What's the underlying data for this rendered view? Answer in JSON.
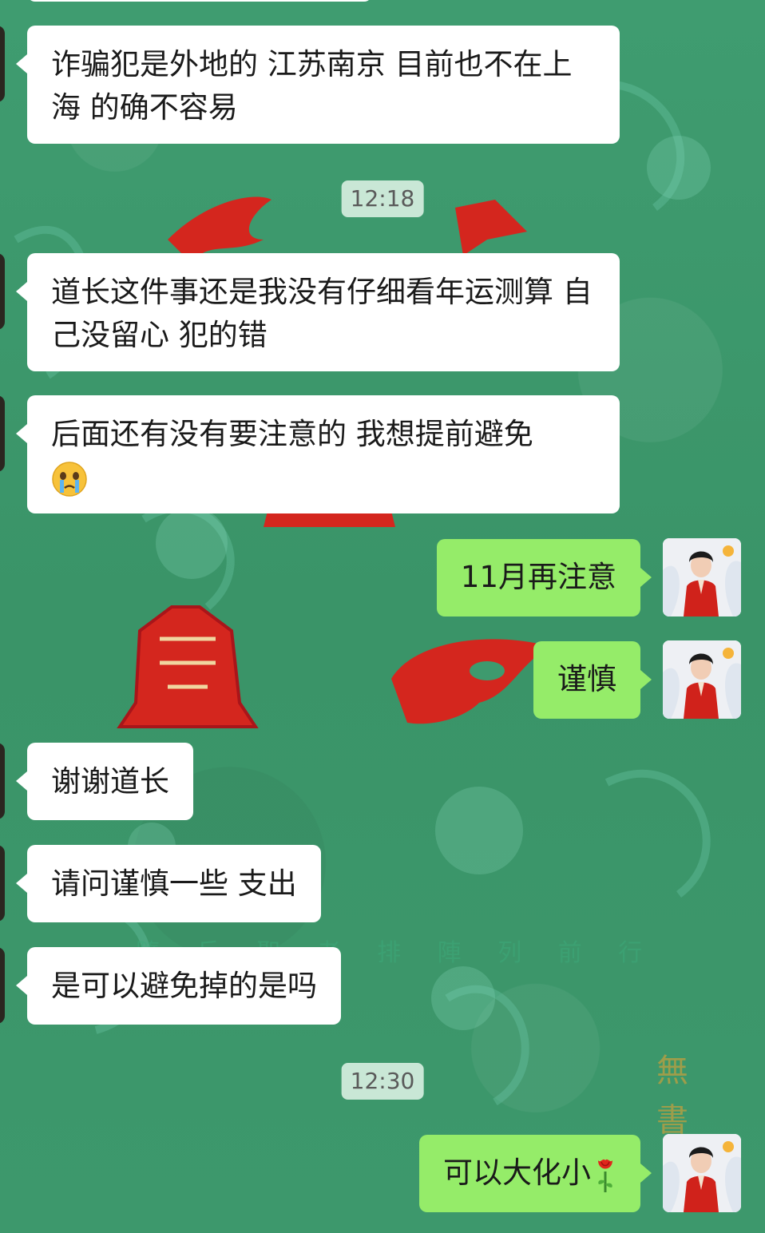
{
  "chat": {
    "messages": [
      {
        "id": "m1",
        "side": "in",
        "text": "诈骗犯是外地的  江苏南京 目前也不在上海 的确不容易"
      },
      {
        "id": "t1",
        "type": "time",
        "text": "12:18"
      },
      {
        "id": "m2",
        "side": "in",
        "text": "道长这件事还是我没有仔细看年运测算 自己没留心 犯的错"
      },
      {
        "id": "m3",
        "side": "in",
        "text": "后面还有没有要注意的 我想提前避免",
        "emoji": "crying-face"
      },
      {
        "id": "m4",
        "side": "out",
        "text": "11月再注意"
      },
      {
        "id": "m5",
        "side": "out",
        "text": "谨慎"
      },
      {
        "id": "m6",
        "side": "in",
        "text": "谢谢道长"
      },
      {
        "id": "m7",
        "side": "in",
        "text": "请问谨慎一些 支出"
      },
      {
        "id": "m8",
        "side": "in",
        "text": "是可以避免掉的是吗"
      },
      {
        "id": "t2",
        "type": "time",
        "text": "12:30"
      },
      {
        "id": "m9",
        "side": "out",
        "text": "可以大化小",
        "emoji": "rose"
      }
    ]
  },
  "background": {
    "calligraphy": "隨 兵 聖 者 排 陣 列 前 行",
    "side_text": "無 書"
  },
  "colors": {
    "background": "#3e9a6e",
    "incoming_bubble": "#ffffff",
    "outgoing_bubble": "#95ec69",
    "timestamp_bg": "#c9e7d6",
    "decoration_red": "#e0261c"
  }
}
